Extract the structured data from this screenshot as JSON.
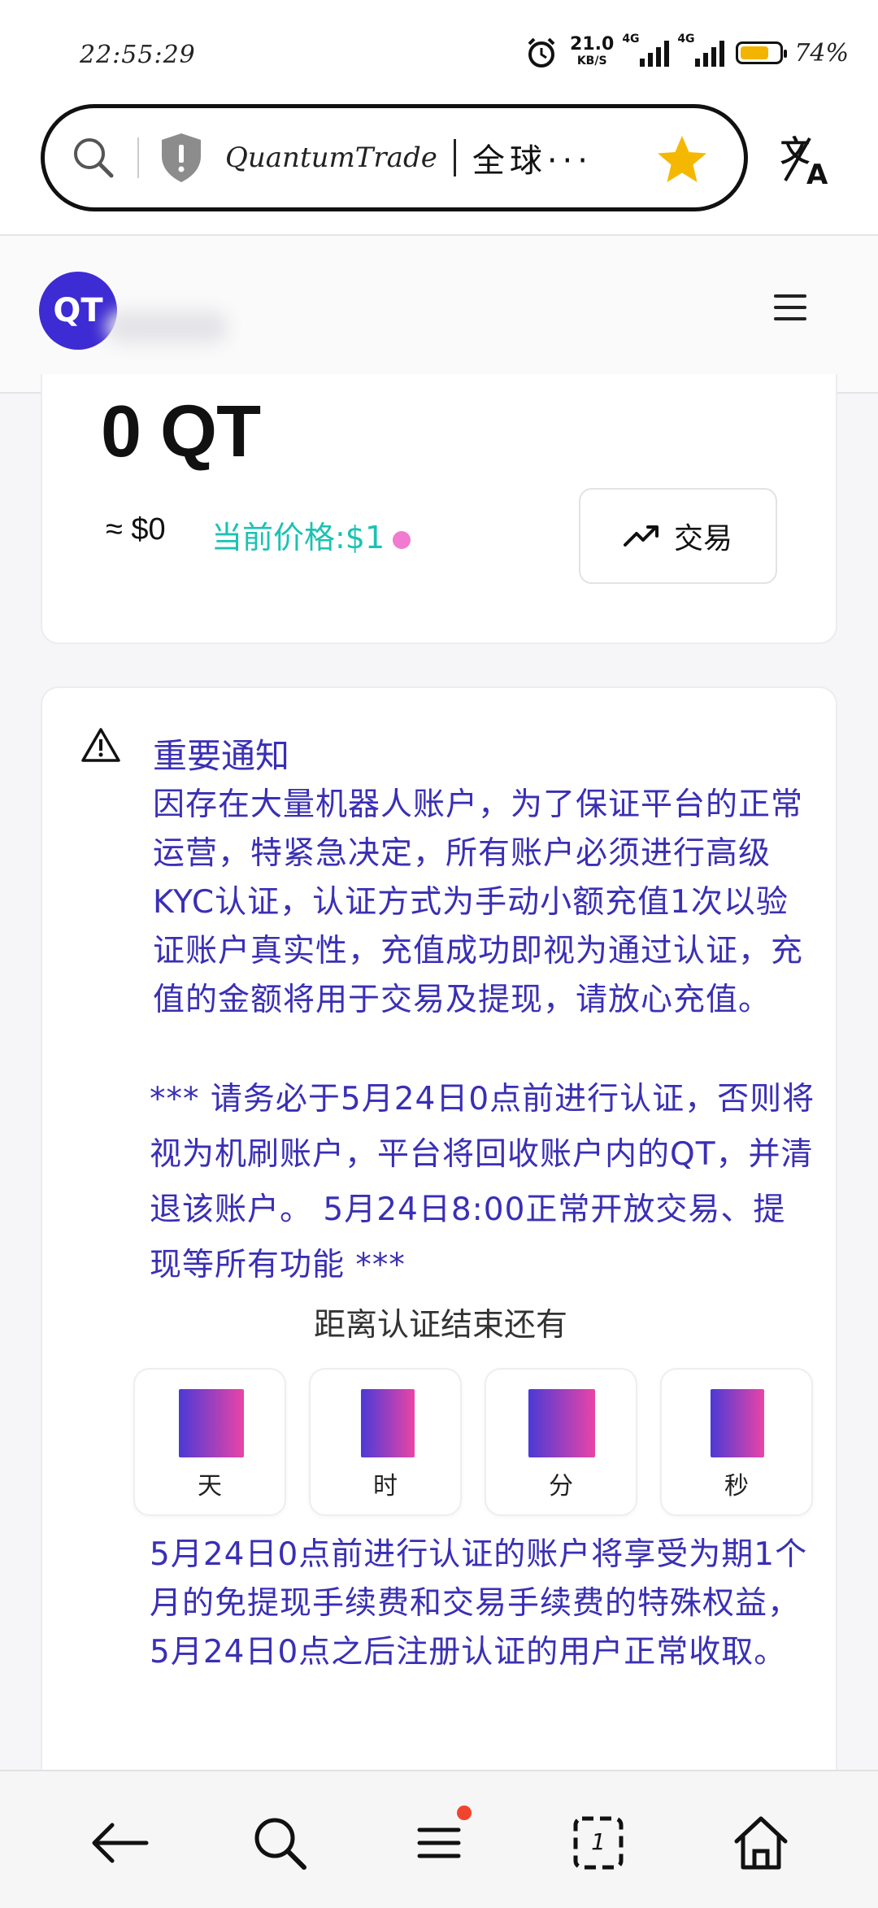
{
  "status_bar": {
    "time": "22:55:29",
    "net_speed_value": "21.0",
    "net_speed_unit": "KB/S",
    "signal_1_label": "4G",
    "signal_2_label": "4G",
    "battery_level": 0.74,
    "battery_text": "74%",
    "battery_color": "#f2b400"
  },
  "browser": {
    "url_site_name": "QuantumTrade",
    "url_title_cn": "全球···",
    "star_color": "#f5b800",
    "translate_label": "文A"
  },
  "site_header": {
    "avatar_text": "QT",
    "brand_color": "#3d2bd3"
  },
  "balance_card": {
    "balance": "0 QT",
    "approx_usd": "≈ $0",
    "current_price": "当前价格:$1",
    "trade_button_label": "交易"
  },
  "notice": {
    "title": "重要通知",
    "body": "因存在大量机器人账户，为了保证平台的正常运营，特紧急决定，所有账户必须进行高级KYC认证，认证方式为手动小额充值1次以验证账户真实性，充值成功即视为通过认证，充值的金额将用于交易及提现，请放心充值。",
    "deadline_text": "*** 请务必于5月24日0点前进行认证，否则将视为机刷账户，平台将回收账户内的QT，并清退该账户。 5月24日8:00正常开放交易、提现等所有功能 ***",
    "countdown_label": "距离认证结束还有",
    "countdown_units": [
      "天",
      "时",
      "分",
      "秒"
    ],
    "footer_text": "5月24日0点前进行认证的账户将享受为期1个月的免提现手续费和交易手续费的特殊权益，5月24日0点之后注册认证的用户正常收取。",
    "accent_color": "#3a2fb5"
  },
  "bottom_nav": {
    "items": [
      "back-icon",
      "search-icon",
      "menu-icon",
      "tabs-icon",
      "home-icon"
    ],
    "tabs_count": "1",
    "badge_color": "#f0442e"
  }
}
